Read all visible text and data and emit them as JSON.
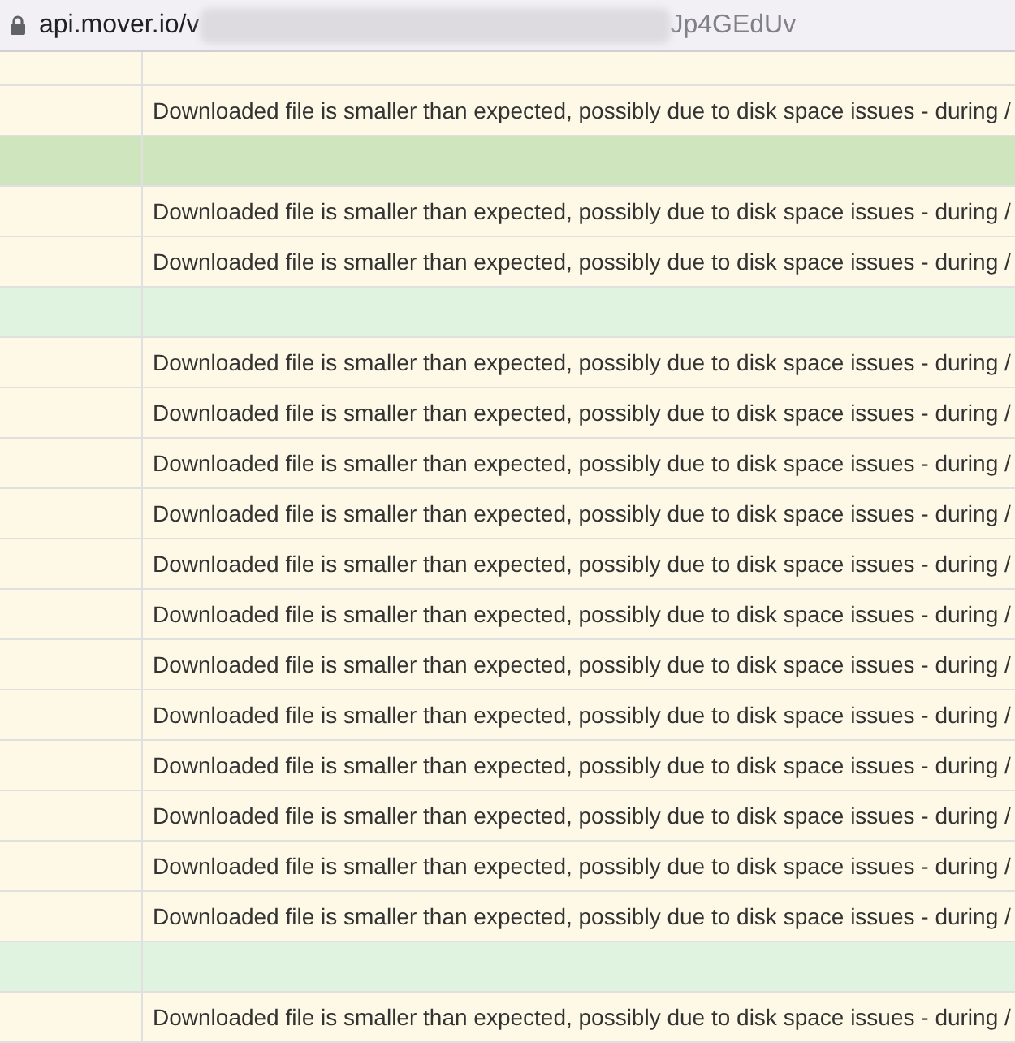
{
  "address_bar": {
    "url_start": "api.mover.io/v",
    "url_end": "Jp4GEdUv"
  },
  "rows": [
    {
      "kind": "warning",
      "hovered": false,
      "message": "Downloaded file is smaller than expected, possibly due to disk space issues - during /"
    },
    {
      "kind": "success",
      "hovered": true
    },
    {
      "kind": "warning",
      "hovered": false,
      "message": "Downloaded file is smaller than expected, possibly due to disk space issues - during /"
    },
    {
      "kind": "warning",
      "hovered": false,
      "message": "Downloaded file is smaller than expected, possibly due to disk space issues - during /"
    },
    {
      "kind": "success",
      "hovered": false
    },
    {
      "kind": "warning",
      "hovered": false,
      "message": "Downloaded file is smaller than expected, possibly due to disk space issues - during /"
    },
    {
      "kind": "warning",
      "hovered": false,
      "message": "Downloaded file is smaller than expected, possibly due to disk space issues - during /"
    },
    {
      "kind": "warning",
      "hovered": false,
      "message": "Downloaded file is smaller than expected, possibly due to disk space issues - during /"
    },
    {
      "kind": "warning",
      "hovered": false,
      "message": "Downloaded file is smaller than expected, possibly due to disk space issues - during /"
    },
    {
      "kind": "warning",
      "hovered": false,
      "message": "Downloaded file is smaller than expected, possibly due to disk space issues - during /"
    },
    {
      "kind": "warning",
      "hovered": false,
      "message": "Downloaded file is smaller than expected, possibly due to disk space issues - during /"
    },
    {
      "kind": "warning",
      "hovered": false,
      "message": "Downloaded file is smaller than expected, possibly due to disk space issues - during /"
    },
    {
      "kind": "warning",
      "hovered": false,
      "message": "Downloaded file is smaller than expected, possibly due to disk space issues - during /"
    },
    {
      "kind": "warning",
      "hovered": false,
      "message": "Downloaded file is smaller than expected, possibly due to disk space issues - during /"
    },
    {
      "kind": "warning",
      "hovered": false,
      "message": "Downloaded file is smaller than expected, possibly due to disk space issues - during /"
    },
    {
      "kind": "warning",
      "hovered": false,
      "message": "Downloaded file is smaller than expected, possibly due to disk space issues - during /"
    },
    {
      "kind": "warning",
      "hovered": false,
      "message": "Downloaded file is smaller than expected, possibly due to disk space issues - during /"
    },
    {
      "kind": "success",
      "hovered": false
    },
    {
      "kind": "warning",
      "hovered": false,
      "message": "Downloaded file is smaller than expected, possibly due to disk space issues - during /"
    }
  ]
}
